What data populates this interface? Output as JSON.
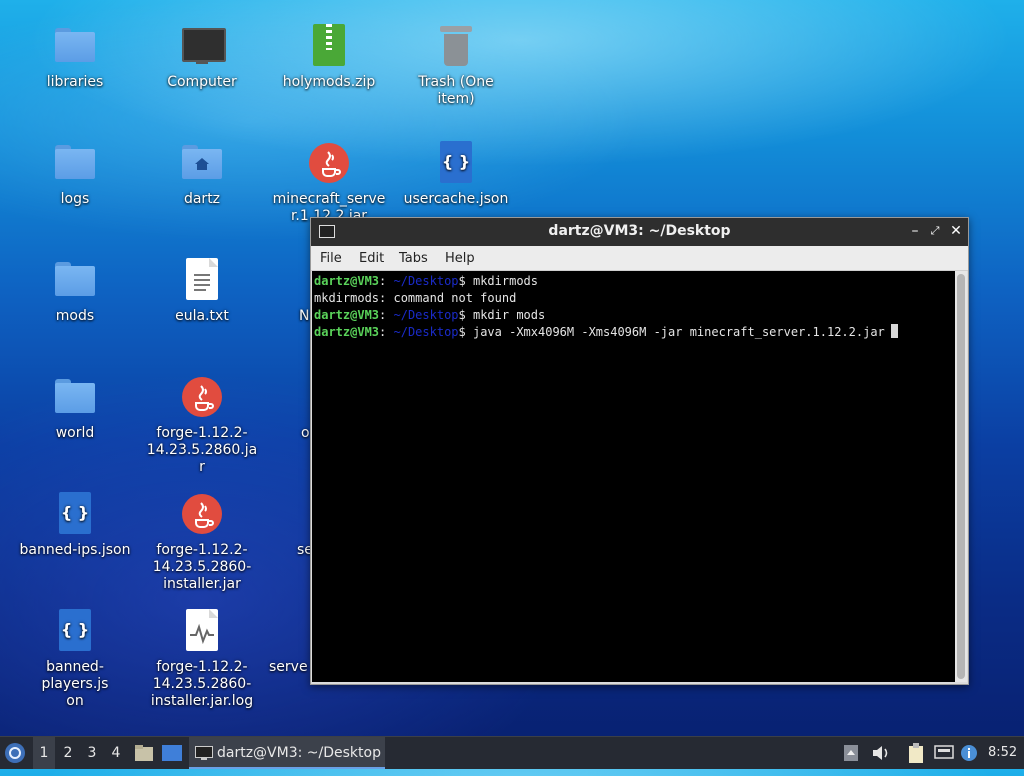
{
  "desktop": {
    "icons": [
      {
        "label": "libraries",
        "type": "folder"
      },
      {
        "label": "Computer",
        "type": "computer"
      },
      {
        "label": "holymods.zip",
        "type": "zip"
      },
      {
        "label": "Trash (One item)",
        "type": "trash"
      },
      {
        "label": "logs",
        "type": "folder"
      },
      {
        "label": "dartz",
        "type": "home-folder"
      },
      {
        "label": "minecraft_server.1.12.2.jar",
        "type": "java"
      },
      {
        "label": "usercache.json",
        "type": "json"
      },
      {
        "label": "mods",
        "type": "folder"
      },
      {
        "label": "eula.txt",
        "type": "text"
      },
      {
        "label": "N",
        "type": "partial"
      },
      {
        "label": "world",
        "type": "folder"
      },
      {
        "label": "forge-1.12.2-14.23.5.2860.jar",
        "type": "java"
      },
      {
        "label": "o",
        "type": "partial"
      },
      {
        "label": "banned-ips.json",
        "type": "json"
      },
      {
        "label": "forge-1.12.2-14.23.5.2860-installer.jar",
        "type": "java"
      },
      {
        "label": "se",
        "type": "partial"
      },
      {
        "label": "banned-players.json",
        "type": "json"
      },
      {
        "label": "forge-1.12.2-14.23.5.2860-installer.jar.log",
        "type": "log"
      },
      {
        "label": "serve",
        "type": "partial"
      }
    ]
  },
  "terminal": {
    "title": "dartz@VM3: ~/Desktop",
    "menu": [
      "File",
      "Edit",
      "Tabs",
      "Help"
    ],
    "lines": [
      {
        "user": "dartz@VM3",
        "sep": ":",
        "path": " ~/Desktop",
        "prompt": "$ ",
        "text": "mkdirmods"
      },
      {
        "text": "mkdirmods: command not found"
      },
      {
        "user": "dartz@VM3",
        "sep": ":",
        "path": " ~/Desktop",
        "prompt": "$ ",
        "text": "mkdir mods"
      },
      {
        "user": "dartz@VM3",
        "sep": ":",
        "path": " ~/Desktop",
        "prompt": "$ ",
        "text": "java -Xmx4096M -Xms4096M -jar minecraft_server.1.12.2.jar"
      }
    ]
  },
  "taskbar": {
    "workspaces": [
      "1",
      "2",
      "3",
      "4"
    ],
    "active_workspace": "1",
    "task_label": "dartz@VM3: ~/Desktop",
    "clock": "8:52"
  },
  "colors": {
    "terminal_user": "#5ad25a",
    "terminal_path": "#1a2bc9",
    "taskbar_bg": "#262a33"
  }
}
